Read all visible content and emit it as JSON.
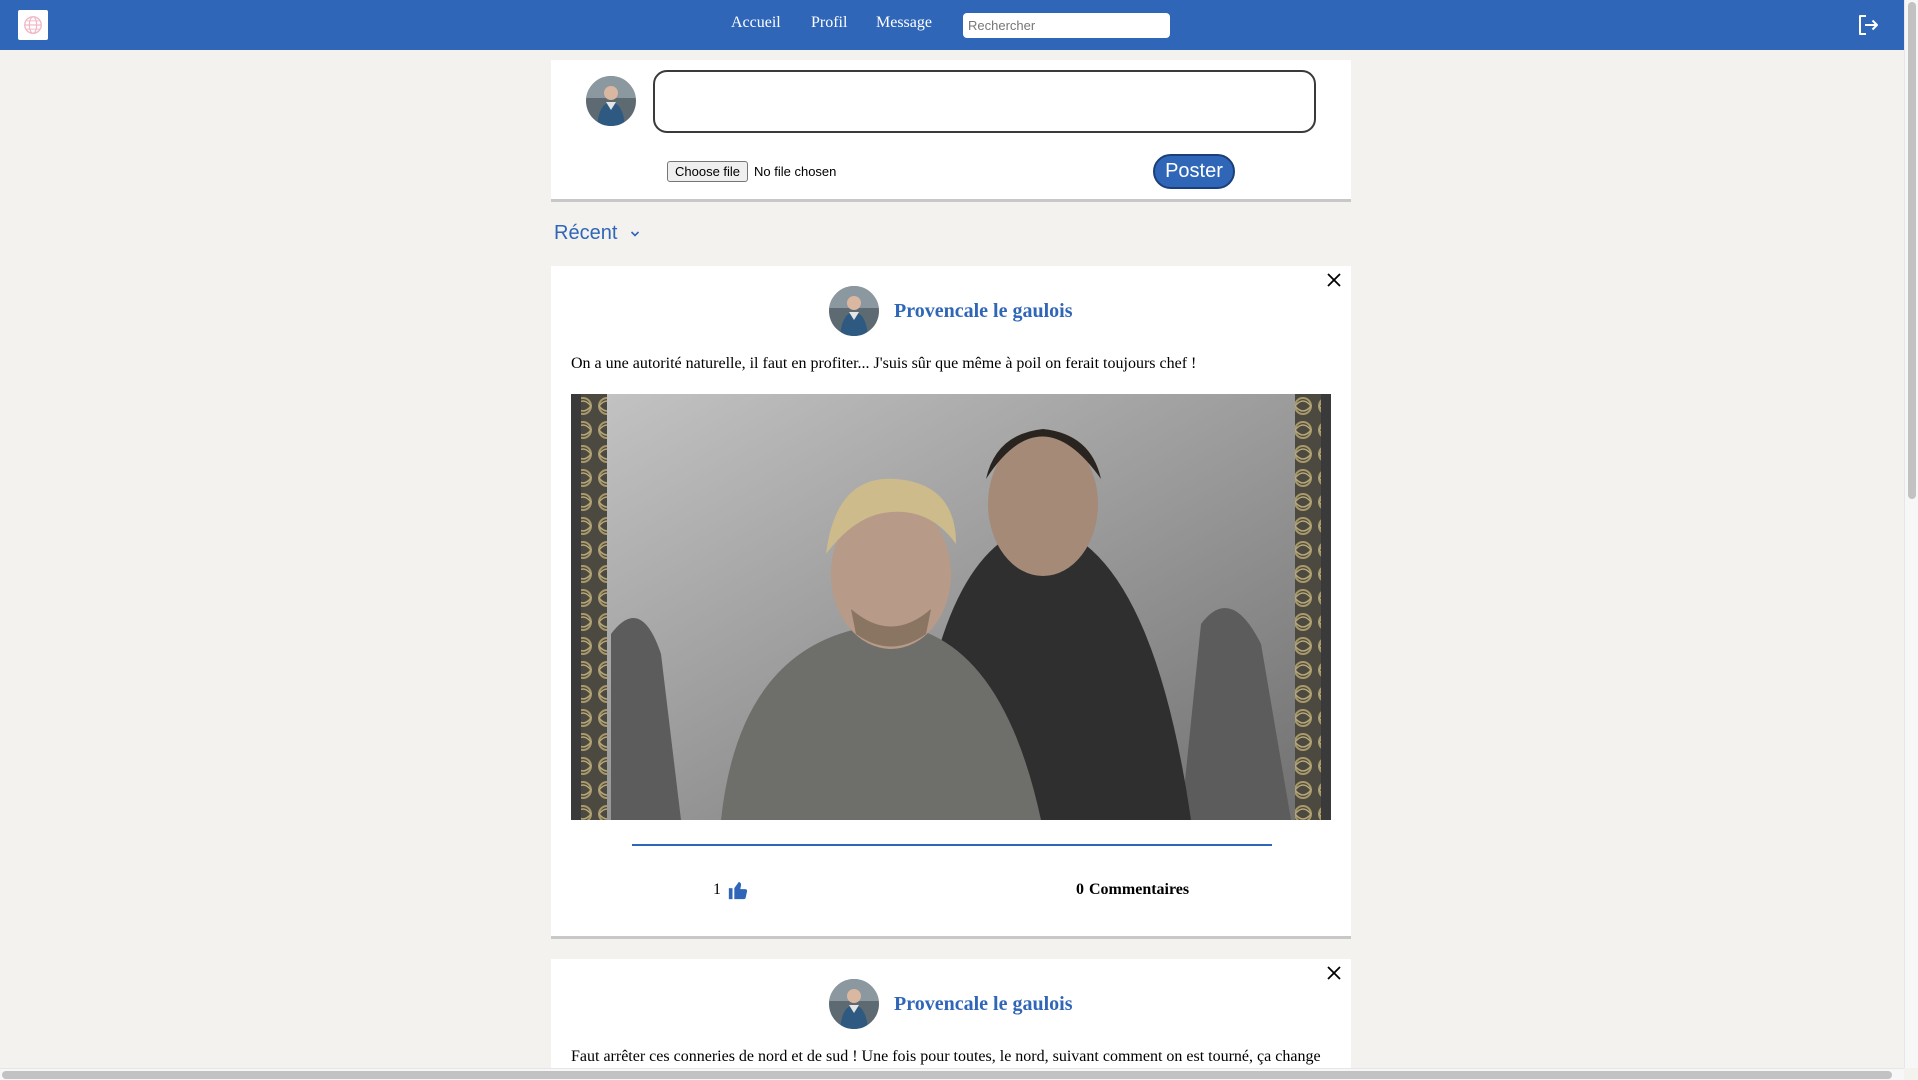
{
  "nav": {
    "links": [
      "Accueil",
      "Profil",
      "Message"
    ],
    "search_placeholder": "Rechercher",
    "logo_icon": "globe-icon",
    "logout_icon": "logout-icon",
    "brand_color": "#2f66b8"
  },
  "composer": {
    "textarea_value": "",
    "file_button": "Choose file",
    "file_status": "No file chosen",
    "submit_label": "Poster"
  },
  "sort": {
    "label": "Récent",
    "icon": "chevron-down-icon"
  },
  "posts": [
    {
      "author": "Provencale le gaulois",
      "text": "On a une autorité naturelle, il faut en profiter... J'suis sûr que même à poil on ferait toujours chef !",
      "has_image": true,
      "likes": "1",
      "comments_count": "0",
      "comments_label": "Commentaires"
    },
    {
      "author": "Provencale le gaulois",
      "text": "Faut arrêter ces conneries de nord et de sud ! Une fois pour toutes, le nord, suivant comment on est tourné, ça change"
    }
  ]
}
